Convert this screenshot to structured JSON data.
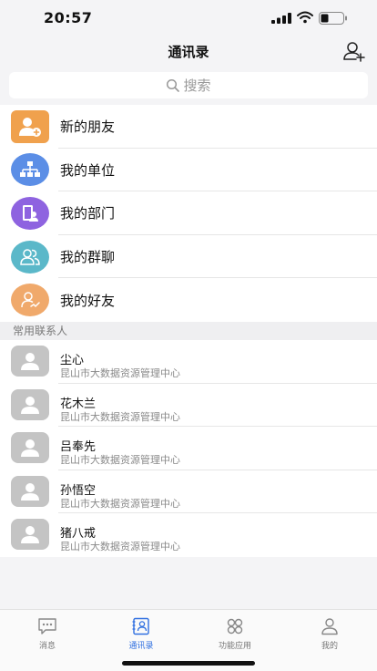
{
  "status_bar": {
    "time": "20:57"
  },
  "nav": {
    "title": "通讯录"
  },
  "search": {
    "placeholder": "搜索"
  },
  "menu": [
    {
      "label": "新的朋友",
      "icon": "new-friend-icon",
      "color": "#f0a14d"
    },
    {
      "label": "我的单位",
      "icon": "org-chart-icon",
      "color": "#5b8ee6"
    },
    {
      "label": "我的部门",
      "icon": "department-icon",
      "color": "#8e63e0"
    },
    {
      "label": "我的群聊",
      "icon": "group-chat-icon",
      "color": "#5bb8c9"
    },
    {
      "label": "我的好友",
      "icon": "friends-icon",
      "color": "#f0a96b"
    }
  ],
  "section": {
    "frequent_contacts": "常用联系人"
  },
  "contacts": [
    {
      "name": "尘心",
      "org": "昆山市大数据资源管理中心"
    },
    {
      "name": "花木兰",
      "org": "昆山市大数据资源管理中心"
    },
    {
      "name": "吕奉先",
      "org": "昆山市大数据资源管理中心"
    },
    {
      "name": "孙悟空",
      "org": "昆山市大数据资源管理中心"
    },
    {
      "name": "猪八戒",
      "org": "昆山市大数据资源管理中心"
    }
  ],
  "tabs": [
    {
      "label": "消息",
      "icon": "message-icon",
      "active": false
    },
    {
      "label": "通讯录",
      "icon": "contacts-icon",
      "active": true
    },
    {
      "label": "功能应用",
      "icon": "apps-icon",
      "active": false
    },
    {
      "label": "我的",
      "icon": "profile-icon",
      "active": false
    }
  ],
  "colors": {
    "accent": "#2f6fe0",
    "avatar_placeholder": "#c4c4c4"
  }
}
